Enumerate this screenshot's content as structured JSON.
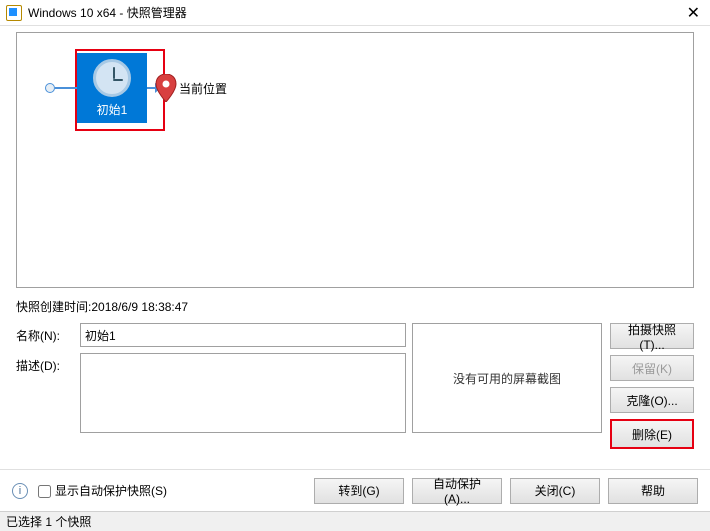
{
  "window": {
    "title": "Windows 10 x64 - 快照管理器"
  },
  "snapshot": {
    "selected_name": "初始1",
    "current_pos_label": "当前位置"
  },
  "meta": {
    "created_label": "快照创建时间:",
    "created_value": "2018/6/9 18:38:47",
    "name_label": "名称(N):",
    "name_value": "初始1",
    "desc_label": "描述(D):",
    "desc_value": "",
    "no_thumb": "没有可用的屏幕截图"
  },
  "side": {
    "take": "拍摄快照(T)...",
    "keep": "保留(K)",
    "clone": "克隆(O)...",
    "delete": "删除(E)"
  },
  "bottom": {
    "autoprotect_label": "显示自动保护快照(S)",
    "goto": "转到(G)",
    "auto": "自动保护(A)...",
    "close": "关闭(C)",
    "help": "帮助"
  },
  "status": "已选择 1 个快照"
}
